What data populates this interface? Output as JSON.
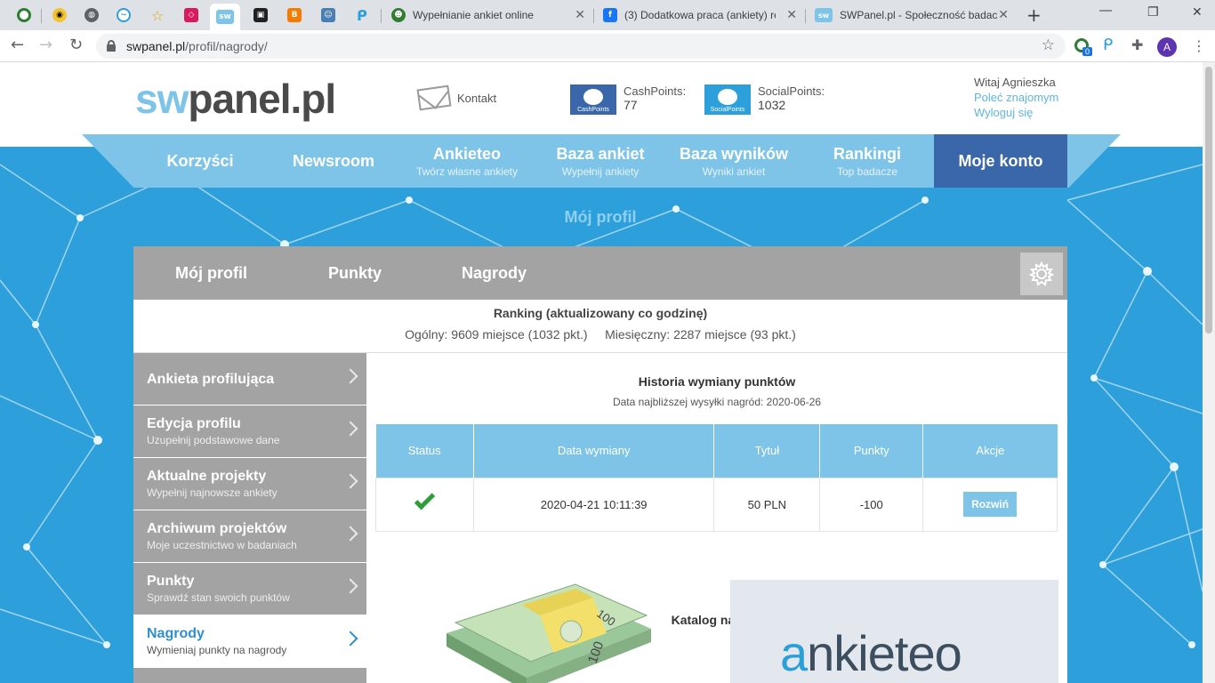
{
  "browser": {
    "tabs": [
      {
        "title": "Wypełnianie ankiet online"
      },
      {
        "title": "(3) Dodatkowa praca (ankiety) re"
      },
      {
        "title": "SWPanel.pl - Społeczność badacz"
      }
    ],
    "pinned_labels": {
      "swpanel": "sw"
    },
    "url_host": "swpanel.pl",
    "url_path": "/profil/nagrody/",
    "extension_badge": "0",
    "avatar_letter": "A",
    "new_tab_glyph": "+",
    "close_glyph": "✕",
    "colors": {
      "facebook": "#1877f2",
      "swpanel_tab": "#7ec4e8"
    }
  },
  "header": {
    "logo_sw": "sw",
    "logo_rest": "panel.pl",
    "contact_label": "Kontakt",
    "cash_icon_text": "CashPoints",
    "cash_label": "CashPoints:",
    "cash_value": "77",
    "social_icon_text": "SocialPoints",
    "social_label": "SocialPoints:",
    "social_value": "1032",
    "greeting": "Witaj Agnieszka",
    "recommend_link": "Poleć znajomym",
    "logout_link": "Wyloguj się"
  },
  "nav": {
    "items": [
      {
        "main": "Korzyści",
        "sub": ""
      },
      {
        "main": "Newsroom",
        "sub": ""
      },
      {
        "main": "Ankieteo",
        "sub": "Twórz własne ankiety"
      },
      {
        "main": "Baza ankiet",
        "sub": "Wypełnij ankiety"
      },
      {
        "main": "Baza wyników",
        "sub": "Wyniki ankiet"
      },
      {
        "main": "Rankingi",
        "sub": "Top badacze"
      },
      {
        "main": "Moje konto",
        "sub": ""
      }
    ],
    "colors": {
      "band": "#7ec4e8",
      "active": "#3a67aa"
    }
  },
  "breadcrumb": "Mój profil",
  "profile_tabs": [
    "Mój profil",
    "Punkty",
    "Nagrody"
  ],
  "ranking": {
    "title": "Ranking (aktualizowany co godzinę)",
    "overall": "Ogólny: 9609 miejsce (1032 pkt.)",
    "monthly": "Miesięczny: 2287 miejsce (93 pkt.)"
  },
  "sidebar": [
    {
      "label": "Ankieta profilująca",
      "sub": ""
    },
    {
      "label": "Edycja profilu",
      "sub": "Uzupełnij podstawowe dane"
    },
    {
      "label": "Aktualne projekty",
      "sub": "Wypełnij najnowsze ankiety"
    },
    {
      "label": "Archiwum projektów",
      "sub": "Moje uczestnictwo w badaniach"
    },
    {
      "label": "Punkty",
      "sub": "Sprawdź stan swoich punktów"
    },
    {
      "label": "Nagrody",
      "sub": "Wymieniaj punkty na nagrody"
    }
  ],
  "history": {
    "title": "Historia wymiany punktów",
    "next_shipping": "Data najbliższej wysyłki nagród: 2020-06-26",
    "columns": [
      "Status",
      "Data wymiany",
      "Tytuł",
      "Punkty",
      "Akcje"
    ],
    "rows": [
      {
        "date": "2020-04-21 10:11:39",
        "title": "50 PLN",
        "points": "-100",
        "action": "Rozwiń"
      }
    ]
  },
  "catalog": {
    "title": "Katalog nagród",
    "card_brand_a": "a",
    "card_brand_rest": "nkieteo",
    "banknote_text": "100"
  },
  "colors": {
    "accent": "#7ec4e8",
    "link": "#5fb4e2",
    "background": "#2d9fdb",
    "success": "#2e9d3a",
    "panel_gray": "#a3a3a3"
  }
}
